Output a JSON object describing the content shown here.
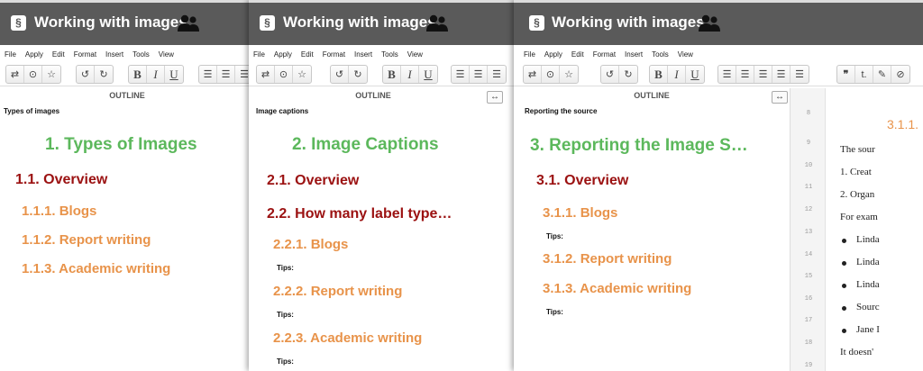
{
  "app": {
    "title": "Working with images",
    "section_glyph": "§"
  },
  "menu": [
    "File",
    "Apply",
    "Edit",
    "Format",
    "Insert",
    "Tools",
    "View"
  ],
  "outline_header": "OUTLINE",
  "panes": [
    {
      "subtitle": "Types of images",
      "h1": "1.  Types of Images",
      "h2": [
        "1.1.  Overview"
      ],
      "h3": [
        "1.1.1.  Blogs",
        "1.1.2.  Report writing",
        "1.1.3.  Academic writing"
      ]
    },
    {
      "subtitle": "Image captions",
      "h1": "2.  Image Captions",
      "h2": [
        "2.1.  Overview",
        "2.2.  How many label type…"
      ],
      "h3": [
        "2.2.1.  Blogs",
        "2.2.2.  Report writing",
        "2.2.3.  Academic writing"
      ],
      "tips": [
        "Tips:",
        "Tips:",
        "Tips:"
      ]
    },
    {
      "subtitle": "Reporting the source",
      "h1": "3.  Reporting the Image S…",
      "h2": [
        "3.1.  Overview"
      ],
      "h3": [
        "3.1.1.  Blogs",
        "3.1.2.  Report writing",
        "3.1.3.  Academic writing"
      ],
      "tips": [
        "Tips:",
        "Tips:"
      ]
    }
  ],
  "line_numbers": [
    "8",
    "9",
    "10",
    "11",
    "12",
    "13",
    "14",
    "15",
    "16",
    "17",
    "18",
    "19"
  ],
  "document": {
    "heading": "3.1.1.",
    "lines": [
      "The sour",
      "1.  Creat",
      "2.  Organ",
      "For exam",
      "Linda",
      "Linda",
      "Linda",
      "Sourc",
      "Jane I",
      "It doesn'"
    ]
  },
  "colors": {
    "h1": "#5cb85c",
    "h2": "#9b1111",
    "h3": "#e8934a",
    "titlebar": "#5a5a5a"
  }
}
